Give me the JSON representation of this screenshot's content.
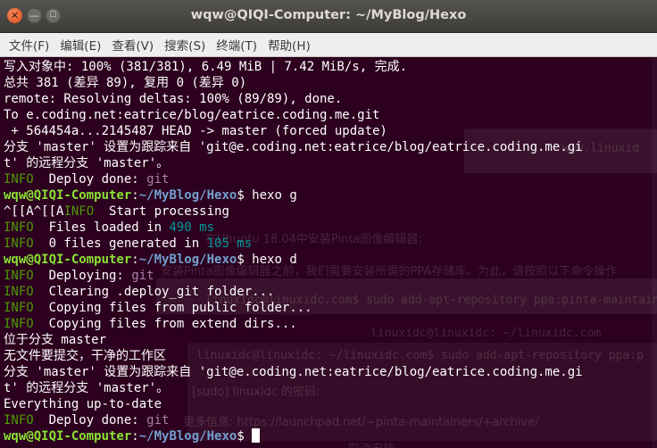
{
  "window": {
    "title": "wqw@QIQI-Computer: ~/MyBlog/Hexo",
    "close_glyph": "✕",
    "minimize_glyph": "—",
    "maximize_glyph": "☐"
  },
  "menu": [
    "文件(F)",
    "编辑(E)",
    "查看(V)",
    "搜索(S)",
    "终端(T)",
    "帮助(H)"
  ],
  "prompt": {
    "user_host": "wqw@QIQI-Computer",
    "colon": ":",
    "path": "~/MyBlog/Hexo",
    "dollar": "$ "
  },
  "terminal": {
    "l1": "写入对象中: 100% (381/381), 6.49 MiB | 7.42 MiB/s, 完成.",
    "l2": "总共 381 (差异 89), 复用 0 (差异 0)",
    "l3": "remote: Resolving deltas: 100% (89/89), done.",
    "l4": "To e.coding.net:eatrice/blog/eatrice.coding.me.git",
    "l5": " + 564454a...2145487 HEAD -> master (forced update)",
    "l6": "分支 'master' 设置为跟踪来自 'git@e.coding.net:eatrice/blog/eatrice.coding.me.gi",
    "l7": "t' 的远程分支 'master'。",
    "l8_tag": "INFO",
    "l8_text": "  Deploy done: ",
    "l8_val": "git",
    "cmd1": "hexo g",
    "l10_pre": "^[[A^[[A",
    "l10_tag": "INFO",
    "l10_text": "  Start processing",
    "l11_tag": "INFO",
    "l11_text": "  Files loaded in ",
    "l11_val": "490 ms",
    "l12_tag": "INFO",
    "l12_text": "  0 files generated in ",
    "l12_val": "105 ms",
    "cmd2": "hexo d",
    "l14_tag": "INFO",
    "l14_text": "  Deploying: ",
    "l14_val": "git",
    "l15_tag": "INFO",
    "l15_text": "  Clearing .deploy_git folder...",
    "l16_tag": "INFO",
    "l16_text": "  Copying files from public folder...",
    "l17_tag": "INFO",
    "l17_text": "  Copying files from extend dirs...",
    "l18": "位于分支 master",
    "l19": "无文件要提交，干净的工作区",
    "l20": "分支 'master' 设置为跟踪来自 'git@e.coding.net:eatrice/blog/eatrice.coding.me.gi",
    "l21": "t' 的远程分支 'master'。",
    "l22": "Everything up-to-date",
    "l23_tag": "INFO",
    "l23_text": "  Deploy done: ",
    "l23_val": "git"
  },
  "background_ghost": {
    "g1": "www.linuxid",
    "g2": "在Ubuntu 18.04中安装Pinta图像编辑器:",
    "g3": "安装Pinta图像编辑器之前，我们需要安装所需的PPA存储库。为此，请按照以下命令操作.",
    "g4": "linuxidc@linuxidc.com$ sudo add-apt-repository ppa:pinta-maintainers/p",
    "g5": "linuxidc@linuxidc: ~/linuxidc.com",
    "g6": "linuxidc@linuxidc: ~/linuxidc.com$ sudo add-apt-repository ppa:p",
    "g7": "[sudo] linuxidc 的密码:",
    "g8": "更多信息: https://launchpad.net/~pinta-maintainers/+archive/",
    "g9": "取消安装"
  }
}
